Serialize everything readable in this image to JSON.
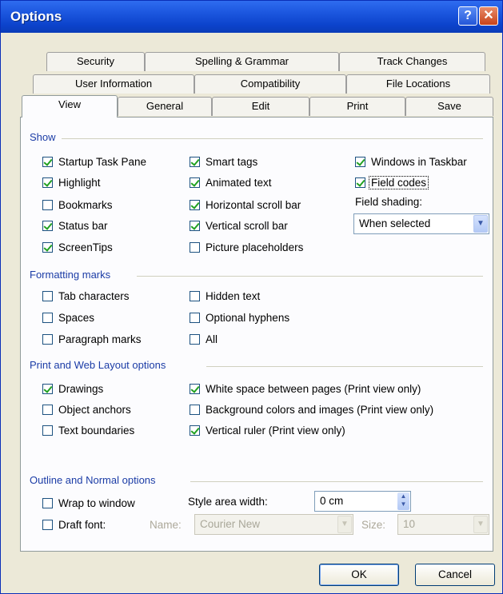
{
  "window": {
    "title": "Options"
  },
  "tabs": {
    "row1": [
      "Security",
      "Spelling & Grammar",
      "Track Changes"
    ],
    "row2": [
      "User Information",
      "Compatibility",
      "File Locations"
    ],
    "row3": [
      "View",
      "General",
      "Edit",
      "Print",
      "Save"
    ],
    "active": "View"
  },
  "show": {
    "heading": "Show",
    "items": [
      {
        "label": "Startup Task Pane",
        "checked": true
      },
      {
        "label": "Highlight",
        "checked": true
      },
      {
        "label": "Bookmarks",
        "checked": false
      },
      {
        "label": "Status bar",
        "checked": true
      },
      {
        "label": "ScreenTips",
        "checked": true
      },
      {
        "label": "Smart tags",
        "checked": true
      },
      {
        "label": "Animated text",
        "checked": true
      },
      {
        "label": "Horizontal scroll bar",
        "checked": true
      },
      {
        "label": "Vertical scroll bar",
        "checked": true
      },
      {
        "label": "Picture placeholders",
        "checked": false
      },
      {
        "label": "Windows in Taskbar",
        "checked": true
      },
      {
        "label": "Field codes",
        "checked": true
      }
    ],
    "field_shading_label": "Field shading:",
    "field_shading_value": "When selected"
  },
  "formatting": {
    "heading": "Formatting marks",
    "items": [
      {
        "label": "Tab characters",
        "checked": false
      },
      {
        "label": "Spaces",
        "checked": false
      },
      {
        "label": "Paragraph marks",
        "checked": false
      },
      {
        "label": "Hidden text",
        "checked": false
      },
      {
        "label": "Optional hyphens",
        "checked": false
      },
      {
        "label": "All",
        "checked": false
      }
    ]
  },
  "print_web": {
    "heading": "Print and Web Layout options",
    "items": [
      {
        "label": "Drawings",
        "checked": true
      },
      {
        "label": "Object anchors",
        "checked": false
      },
      {
        "label": "Text boundaries",
        "checked": false
      },
      {
        "label": "White space between pages (Print view only)",
        "checked": true
      },
      {
        "label": "Background colors and images (Print view only)",
        "checked": false
      },
      {
        "label": "Vertical ruler (Print view only)",
        "checked": true
      }
    ]
  },
  "outline": {
    "heading": "Outline and Normal options",
    "wrap_label": "Wrap to window",
    "wrap_checked": false,
    "draft_label": "Draft font:",
    "draft_checked": false,
    "style_area_label": "Style area width:",
    "style_area_value": "0 cm",
    "name_label": "Name:",
    "name_value": "Courier New",
    "size_label": "Size:",
    "size_value": "10"
  },
  "buttons": {
    "ok": "OK",
    "cancel": "Cancel"
  },
  "icons": {
    "help": "help-icon",
    "close": "close-icon",
    "dropdown": "chevron-down-icon"
  }
}
